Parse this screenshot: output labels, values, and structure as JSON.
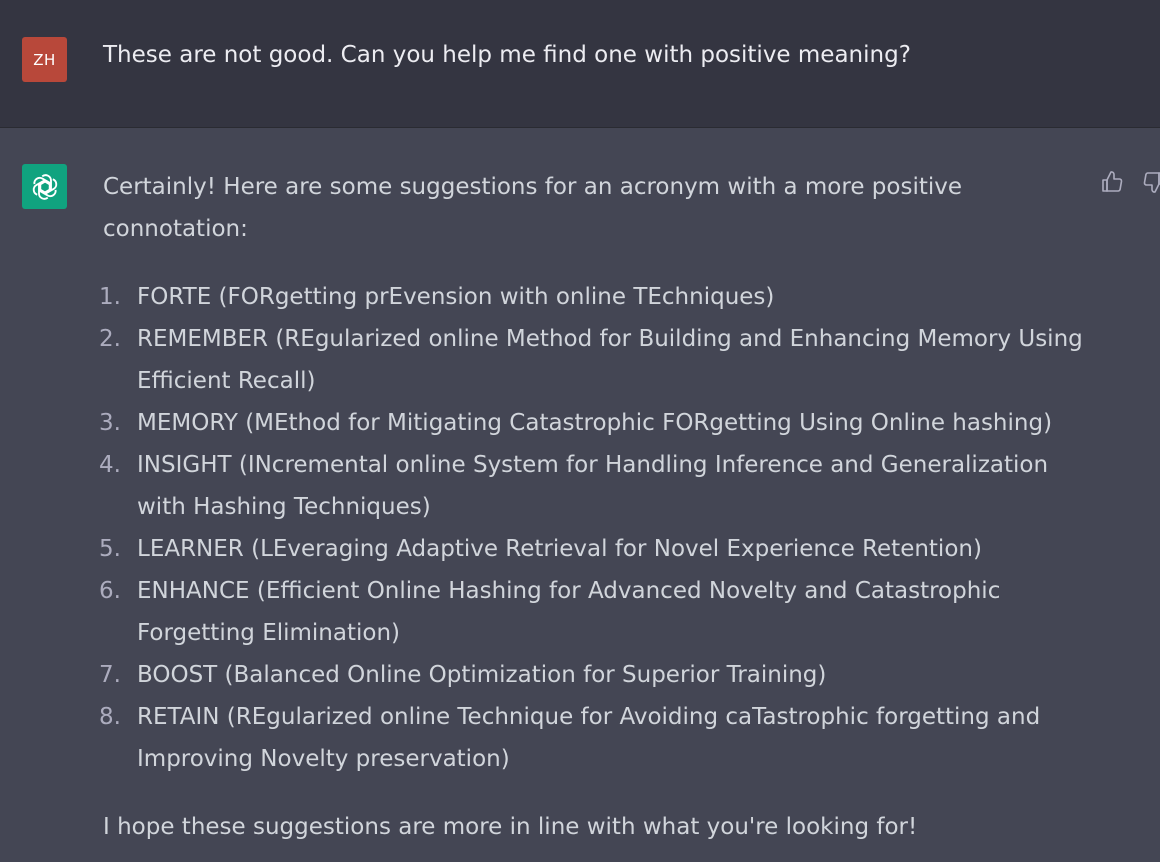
{
  "user_message": {
    "avatar_initials": "ZH",
    "text": "These are not good. Can you help me find one with positive meaning?"
  },
  "assistant_message": {
    "avatar_icon": "openai-logo-icon",
    "intro": "Certainly! Here are some suggestions for an acronym with a more positive connotation:",
    "items": [
      {
        "num": "1.",
        "text": "FORTE (FORgetting prEvension with online TEchniques)"
      },
      {
        "num": "2.",
        "text": "REMEMBER (REgularized online Method for Building and Enhancing Memory Using Efficient Recall)"
      },
      {
        "num": "3.",
        "text": "MEMORY (MEthod for Mitigating Catastrophic FORgetting Using Online hashing)"
      },
      {
        "num": "4.",
        "text": "INSIGHT (INcremental online System for Handling Inference and Generalization with Hashing Techniques)"
      },
      {
        "num": "5.",
        "text": "LEARNER (LEveraging Adaptive Retrieval for Novel Experience Retention)"
      },
      {
        "num": "6.",
        "text": "ENHANCE (Efficient Online Hashing for Advanced Novelty and Catastrophic Forgetting Elimination)"
      },
      {
        "num": "7.",
        "text": "BOOST (Balanced Online Optimization for Superior Training)"
      },
      {
        "num": "8.",
        "text": "RETAIN (REgularized online Technique for Avoiding caTastrophic forgetting and Improving Novelty preservation)"
      }
    ],
    "outro": "I hope these suggestions are more in line with what you're looking for!"
  },
  "feedback": {
    "thumbs_up_icon": "thumbs-up-icon",
    "thumbs_down_icon": "thumbs-down-icon"
  },
  "colors": {
    "user_bg": "#343541",
    "assistant_bg": "#444654",
    "user_avatar": "#b8483a",
    "bot_avatar": "#10a37f",
    "text": "#d1d5db"
  }
}
